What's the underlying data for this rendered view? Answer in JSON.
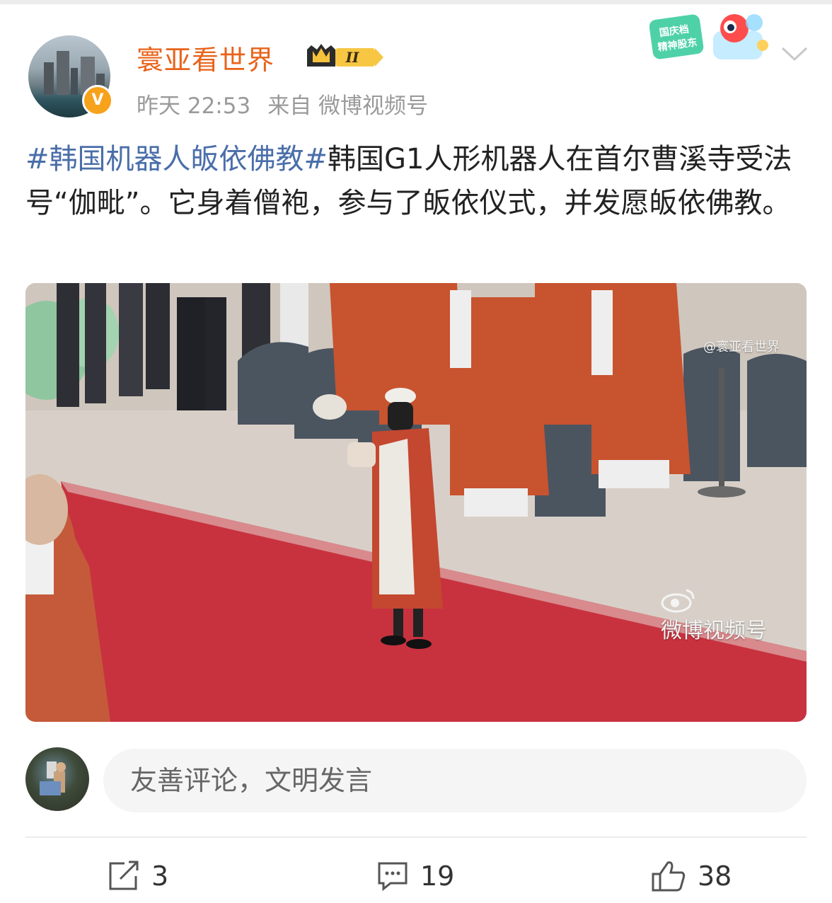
{
  "post": {
    "author": {
      "name": "寰亚看世界",
      "level_badge": "II",
      "verified_badge": "V"
    },
    "meta": {
      "time": "昨天 22:53",
      "source": "来自 微博视频号"
    },
    "event_badge": {
      "line1": "国庆档",
      "line2": "精神股东"
    },
    "text": {
      "hashtag": "#韩国机器人皈依佛教#",
      "body": "韩国G1人形机器人在首尔曹溪寺受法号“伽毗”。它身着僧袍，参与了皈依仪式，并发愿皈依佛教。"
    },
    "video": {
      "watermark_main": "微博视频号",
      "watermark_sub": "@寰亚看世界"
    }
  },
  "comment_box": {
    "placeholder": "友善评论，文明发言"
  },
  "actions": {
    "share_count": "3",
    "comment_count": "19",
    "like_count": "38"
  },
  "icons": {
    "share": "share-icon",
    "comment": "comment-icon",
    "like": "thumbs-up-icon",
    "more": "chevron-down-icon",
    "weibo": "weibo-eye-icon"
  },
  "colors": {
    "username": "#e8631a",
    "hashtag": "#4a6ea9",
    "verified": "#f7a21b",
    "meta": "#9a9a9a"
  }
}
